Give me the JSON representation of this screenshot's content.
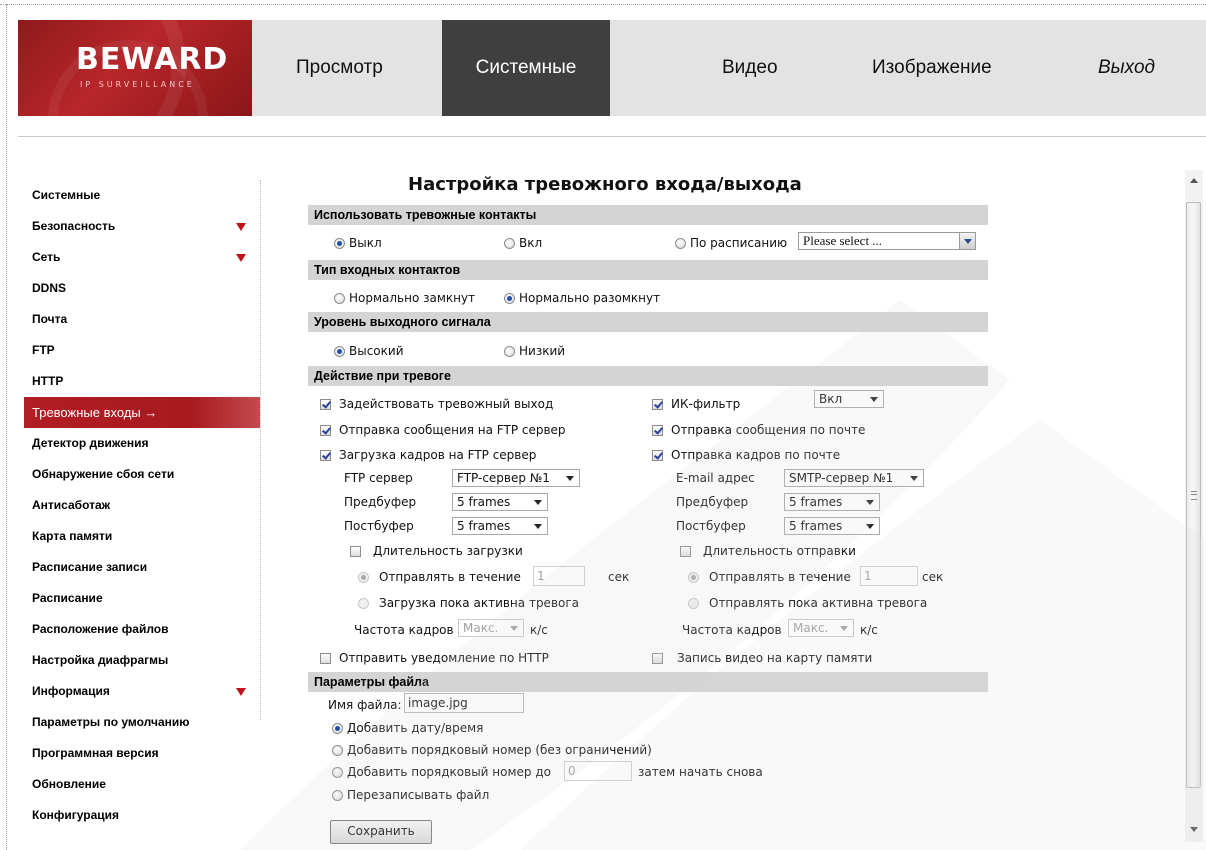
{
  "brand": {
    "name": "BEWARD",
    "tagline": "IP SURVEILLANCE"
  },
  "nav": [
    {
      "label": "Просмотр"
    },
    {
      "label": "Системные"
    },
    {
      "label": "Видео"
    },
    {
      "label": "Изображение"
    },
    {
      "label": "Выход"
    }
  ],
  "sidebar": [
    {
      "label": "Системные"
    },
    {
      "label": "Безопасность"
    },
    {
      "label": "Сеть"
    },
    {
      "label": "DDNS"
    },
    {
      "label": "Почта"
    },
    {
      "label": "FTP"
    },
    {
      "label": "HTTP"
    },
    {
      "label": "Тревожные входы →"
    },
    {
      "label": "Детектор движения"
    },
    {
      "label": "Обнаружение сбоя сети"
    },
    {
      "label": "Антисаботаж"
    },
    {
      "label": "Карта памяти"
    },
    {
      "label": "Расписание записи"
    },
    {
      "label": "Расписание"
    },
    {
      "label": "Расположение файлов"
    },
    {
      "label": "Настройка диафрагмы"
    },
    {
      "label": "Информация"
    },
    {
      "label": "Параметры по умолчанию"
    },
    {
      "label": "Программная версия"
    },
    {
      "label": "Обновление"
    },
    {
      "label": "Конфигурация"
    }
  ],
  "page_title": "Настройка тревожного входа/выхода",
  "use_contacts": {
    "header": "Использовать тревожные контакты",
    "off": "Выкл",
    "on": "Вкл",
    "schedule": "По расписанию",
    "schedule_value": "Please select ..."
  },
  "input_type": {
    "header": "Тип входных контактов",
    "nc": "Нормально замкнут",
    "no": "Нормально разомкнут"
  },
  "output_level": {
    "header": "Уровень выходного сигнала",
    "high": "Высокий",
    "low": "Низкий"
  },
  "alarm_action": {
    "header": "Действие при тревоге",
    "alarm_output": "Задействовать тревожный выход",
    "ir_filter": "ИК-фильтр",
    "ir_filter_value": "Вкл",
    "ftp_message": "Отправка сообщения на FTP сервер",
    "mail_message": "Отправка сообщения по почте",
    "ftp_upload": "Загрузка кадров на FTP сервер",
    "mail_upload": "Отправка кадров по почте",
    "ftp_server_label": "FTP сервер",
    "ftp_server_value": "FTP-сервер №1",
    "email_label": "E-mail адрес",
    "email_value": "SMTP-сервер №1",
    "prebuffer_label": "Предбуфер",
    "prebuffer_value": "5 frames",
    "postbuffer_label": "Постбуфер",
    "postbuffer_value": "5 frames",
    "upload_duration": "Длительность загрузки",
    "send_duration": "Длительность отправки",
    "send_during": "Отправлять в течение",
    "duration_value": "1",
    "sec": "сек",
    "upload_while_active": "Загрузка пока активна тревога",
    "send_while_active": "Отправлять пока активна тревога",
    "frame_rate_label": "Частота кадров",
    "frame_rate_value": "Макс.",
    "fps_unit": "к/с",
    "http_notify": "Отправить уведомление по HTTP",
    "record_card": "Запись видео на карту памяти"
  },
  "file_params": {
    "header": "Параметры файла",
    "name_label": "Имя файла:",
    "name_value": "image.jpg",
    "opt_datetime": "Добавить дату/время",
    "opt_seq_unlimited": "Добавить порядковый номер (без ограничений)",
    "opt_seq_to": "Добавить порядковый номер до",
    "seq_to_value": "0",
    "opt_seq_restart": "затем начать снова",
    "opt_overwrite": "Перезаписывать файл"
  },
  "save_label": "Сохранить"
}
